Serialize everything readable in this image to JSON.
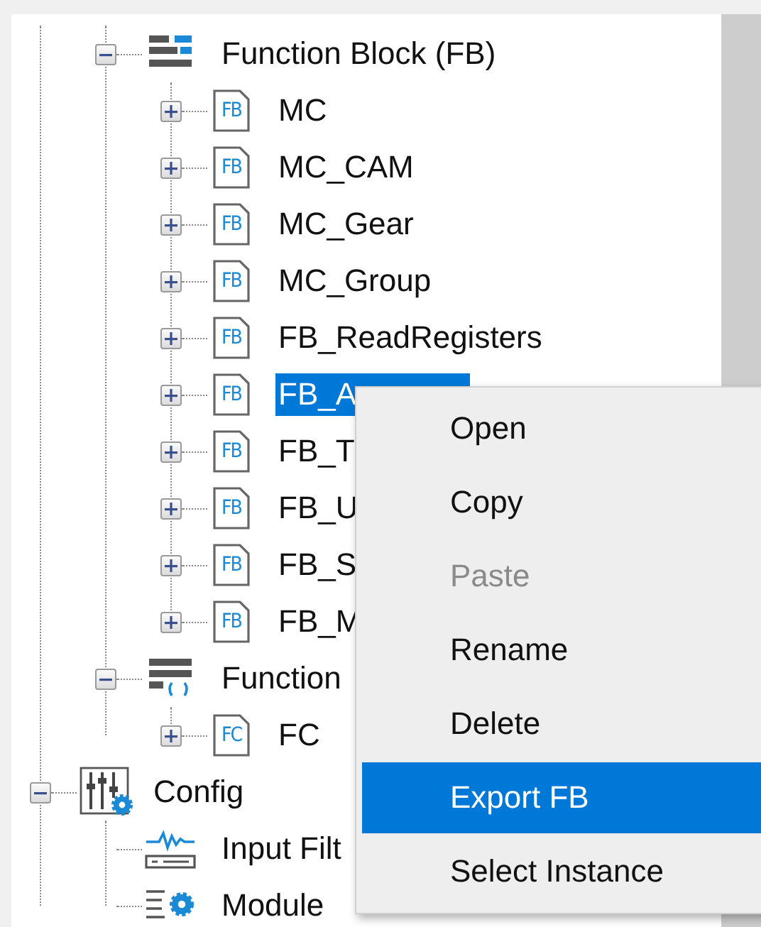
{
  "tree": {
    "continued": [
      {
        "label": "Function Block (FB)",
        "kind": "block-group",
        "expanded": true,
        "selected": false,
        "children": [
          {
            "label": "MC",
            "icon_text": "FB",
            "expanded": false,
            "selected": false
          },
          {
            "label": "MC_CAM",
            "icon_text": "FB",
            "expanded": false,
            "selected": false
          },
          {
            "label": "MC_Gear",
            "icon_text": "FB",
            "expanded": false,
            "selected": false
          },
          {
            "label": "MC_Group",
            "icon_text": "FB",
            "expanded": false,
            "selected": false
          },
          {
            "label": "FB_ReadRegisters",
            "icon_text": "FB",
            "expanded": false,
            "selected": false
          },
          {
            "label": "FB_A",
            "icon_text": "FB",
            "expanded": false,
            "selected": true
          },
          {
            "label": "FB_T",
            "icon_text": "FB",
            "expanded": false,
            "selected": false
          },
          {
            "label": "FB_U",
            "icon_text": "FB",
            "expanded": false,
            "selected": false
          },
          {
            "label": "FB_S",
            "icon_text": "FB",
            "expanded": false,
            "selected": false
          },
          {
            "label": "FB_M",
            "icon_text": "FB",
            "expanded": false,
            "selected": false
          }
        ]
      },
      {
        "label": "Function",
        "kind": "function-group",
        "expanded": true,
        "selected": false,
        "children": [
          {
            "label": "FC",
            "icon_text": "FC",
            "expanded": false,
            "selected": false
          }
        ]
      }
    ],
    "roots": [
      {
        "label": "Config",
        "kind": "config",
        "expanded": true,
        "selected": false,
        "children": [
          {
            "label": "Input Filt",
            "kind": "filter",
            "selected": false
          },
          {
            "label": "Module",
            "kind": "module",
            "selected": false
          }
        ]
      }
    ]
  },
  "context_menu": [
    {
      "label": "Open",
      "disabled": false,
      "selected": false
    },
    {
      "label": "Copy",
      "disabled": false,
      "selected": false
    },
    {
      "label": "Paste",
      "disabled": true,
      "selected": false
    },
    {
      "label": "Rename",
      "disabled": false,
      "selected": false
    },
    {
      "label": "Delete",
      "disabled": false,
      "selected": false
    },
    {
      "label": "Export FB",
      "disabled": false,
      "selected": true
    },
    {
      "label": "Select Instance",
      "disabled": false,
      "selected": false
    }
  ]
}
